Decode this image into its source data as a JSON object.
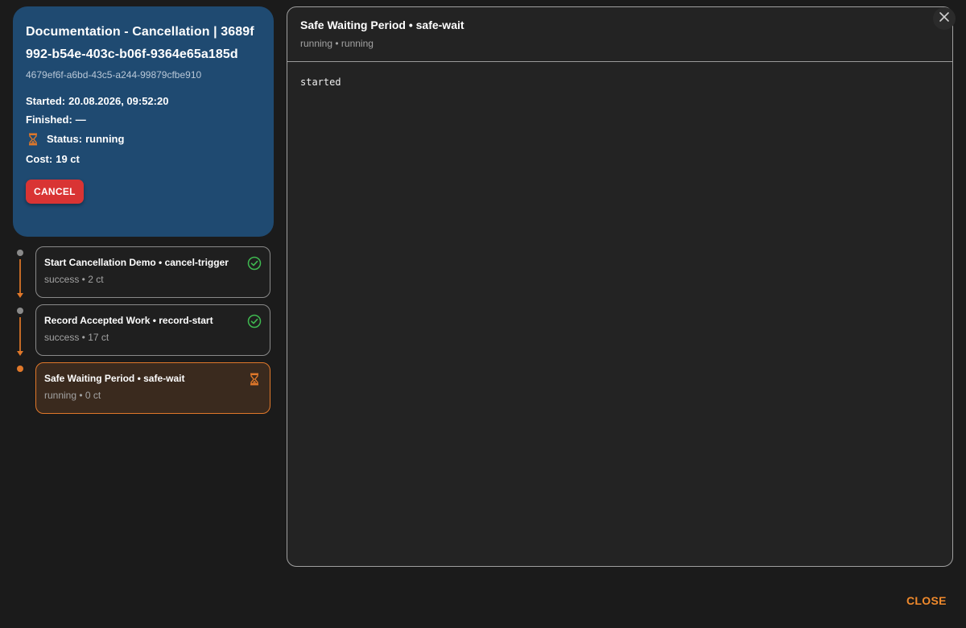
{
  "run": {
    "title": "Documentation - Cancellation | 3689f992-b54e-403c-b06f-9364e65a185d",
    "sub_id": "4679ef6f-a6bd-43c5-a244-99879cfbe910",
    "started_label": "Started:",
    "started_value": "20.08.2026, 09:52:20",
    "finished_label": "Finished:",
    "finished_value": "—",
    "status_label": "Status:",
    "status_value": "running",
    "status_icon": "hourglass-icon",
    "cost_label": "Cost:",
    "cost_value": "19 ct",
    "cancel_label": "CANCEL",
    "card_color": "#1f4a71",
    "cancel_color": "#d93434"
  },
  "steps": [
    {
      "title": "Start Cancellation Demo • cancel-trigger",
      "meta": "success • 2 ct",
      "status": "success",
      "icon": "check-circle-icon"
    },
    {
      "title": "Record Accepted Work • record-start",
      "meta": "success • 17 ct",
      "status": "success",
      "icon": "check-circle-icon"
    },
    {
      "title": "Safe Waiting Period • safe-wait",
      "meta": "running • 0 ct",
      "status": "running",
      "icon": "hourglass-icon"
    }
  ],
  "detail": {
    "title": "Safe Waiting Period • safe-wait",
    "subtitle": "running • running",
    "log": "started"
  },
  "footer": {
    "close_label": "CLOSE"
  },
  "colors": {
    "accent": "#e0782a",
    "success": "#3fb950",
    "background": "#1b1b1b"
  }
}
